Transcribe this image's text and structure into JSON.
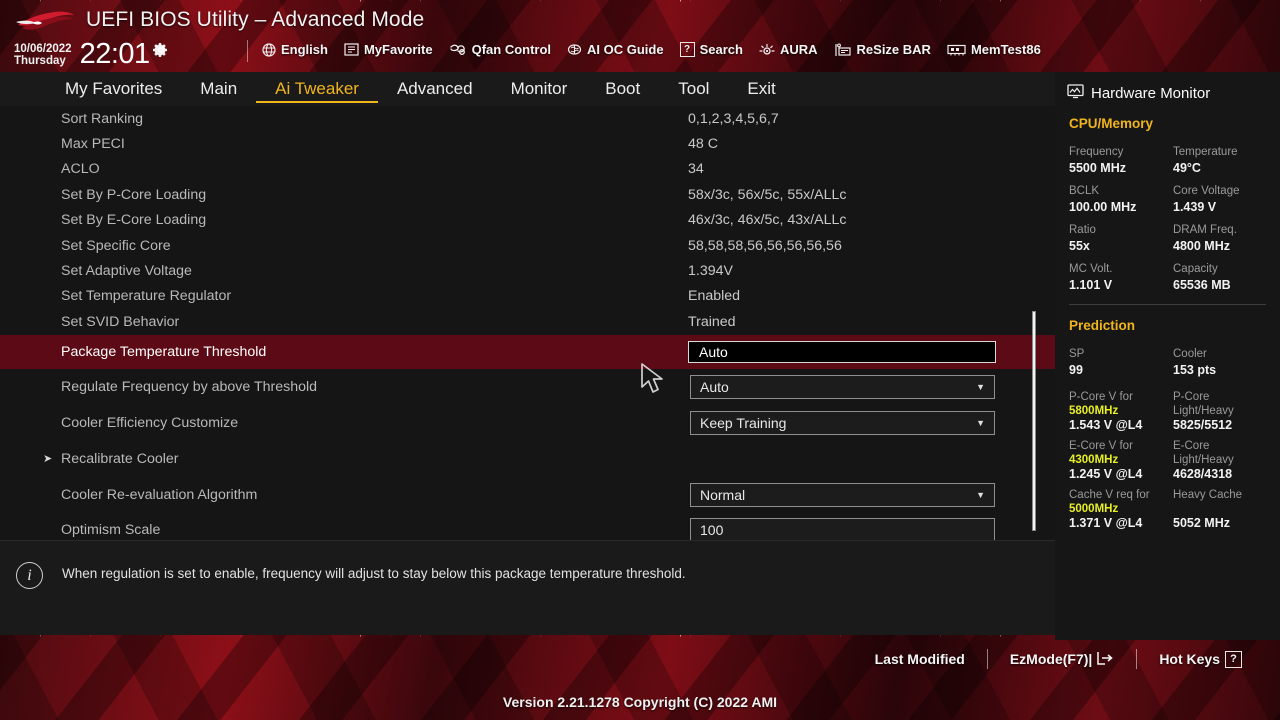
{
  "header": {
    "title": "UEFI BIOS Utility – Advanced Mode",
    "date": "10/06/2022",
    "weekday": "Thursday",
    "time": "22:01",
    "gear_icon": "gear-icon",
    "tools": [
      {
        "label": "English",
        "icon": "globe-icon"
      },
      {
        "label": "MyFavorite",
        "icon": "list-icon"
      },
      {
        "label": "Qfan Control",
        "icon": "fan-icon"
      },
      {
        "label": "AI OC Guide",
        "icon": "brain-icon"
      },
      {
        "label": "Search",
        "icon": "question-box-icon"
      },
      {
        "label": "AURA",
        "icon": "light-icon"
      },
      {
        "label": "ReSize BAR",
        "icon": "resize-bar-icon"
      },
      {
        "label": "MemTest86",
        "icon": "memtest-icon"
      }
    ]
  },
  "nav": {
    "tabs": [
      {
        "label": "My Favorites",
        "active": false
      },
      {
        "label": "Main",
        "active": false
      },
      {
        "label": "Ai Tweaker",
        "active": true
      },
      {
        "label": "Advanced",
        "active": false
      },
      {
        "label": "Monitor",
        "active": false
      },
      {
        "label": "Boot",
        "active": false
      },
      {
        "label": "Tool",
        "active": false
      },
      {
        "label": "Exit",
        "active": false
      }
    ],
    "active_color": "#f0b41c"
  },
  "main": {
    "rows": [
      {
        "label": "Sort Ranking",
        "value": "0,1,2,3,4,5,6,7"
      },
      {
        "label": "Max PECI",
        "value": "48 C"
      },
      {
        "label": "ACLO",
        "value": "34"
      },
      {
        "label": "Set By P-Core Loading",
        "value": "58x/3c, 56x/5c, 55x/ALLc"
      },
      {
        "label": "Set By E-Core Loading",
        "value": "46x/3c, 46x/5c, 43x/ALLc"
      },
      {
        "label": "Set Specific Core",
        "value": "58,58,58,56,56,56,56,56"
      },
      {
        "label": "Set Adaptive Voltage",
        "value": "1.394V"
      },
      {
        "label": "Set Temperature Regulator",
        "value": "Enabled"
      },
      {
        "label": "Set SVID Behavior",
        "value": "Trained"
      }
    ],
    "selected_row": {
      "label": "Package Temperature Threshold",
      "value": "Auto",
      "widget": "input"
    },
    "widget_rows": [
      {
        "label": "Regulate Frequency by above Threshold",
        "value": "Auto",
        "widget": "select"
      },
      {
        "label": "Cooler Efficiency Customize",
        "value": "Keep Training",
        "widget": "select"
      }
    ],
    "submenu_row": {
      "label": "Recalibrate Cooler",
      "arrow": "right-arrow-icon"
    },
    "widget_rows2": [
      {
        "label": "Cooler Re-evaluation Algorithm",
        "value": "Normal",
        "widget": "select"
      },
      {
        "label": "Optimism Scale",
        "value": "100",
        "widget": "input"
      }
    ],
    "highlight_color": "#5c0b16"
  },
  "help": {
    "icon": "info-icon",
    "text": "When regulation is set to enable, frequency will adjust to stay below this package temperature threshold."
  },
  "hwmon": {
    "title": "Hardware Monitor",
    "title_icon": "monitor-icon",
    "sections": [
      {
        "name": "CPU/Memory",
        "pairs": [
          {
            "k": "Frequency",
            "v": "5500 MHz",
            "k2": "Temperature",
            "v2": "49°C"
          },
          {
            "k": "BCLK",
            "v": "100.00 MHz",
            "k2": "Core Voltage",
            "v2": "1.439 V"
          },
          {
            "k": "Ratio",
            "v": "55x",
            "k2": "DRAM Freq.",
            "v2": "4800 MHz"
          },
          {
            "k": "MC Volt.",
            "v": "1.101 V",
            "k2": "Capacity",
            "v2": "65536 MB"
          }
        ]
      },
      {
        "name": "Prediction",
        "pairs": [
          {
            "k": "SP",
            "v": "99",
            "k2": "Cooler",
            "v2": "153 pts"
          }
        ],
        "pred": [
          {
            "k_pre": "P-Core V for ",
            "k_hl": "5800MHz",
            "k_post": "",
            "v": "1.543 V @L4",
            "k2": "P-Core Light/Heavy",
            "v2": "5825/5512"
          },
          {
            "k_pre": "E-Core V for ",
            "k_hl": "4300MHz",
            "k_post": "",
            "v": "1.245 V @L4",
            "k2": "E-Core Light/Heavy",
            "v2": "4628/4318"
          },
          {
            "k_pre": "Cache V req for ",
            "k_hl": "5000MHz",
            "k_post": "",
            "v": "1.371 V @L4",
            "k2": "Heavy Cache",
            "v2": "5052 MHz"
          }
        ]
      }
    ],
    "accent_color": "#f0b41c",
    "highlight_color": "#e8f024"
  },
  "footer": {
    "links": [
      {
        "label": "Last Modified",
        "icon": ""
      },
      {
        "label": "EzMode(F7)|",
        "icon": "exit-arrow-icon"
      },
      {
        "label": "Hot Keys",
        "icon": "question-box-icon"
      }
    ],
    "version": "Version 2.21.1278 Copyright (C) 2022 AMI"
  }
}
